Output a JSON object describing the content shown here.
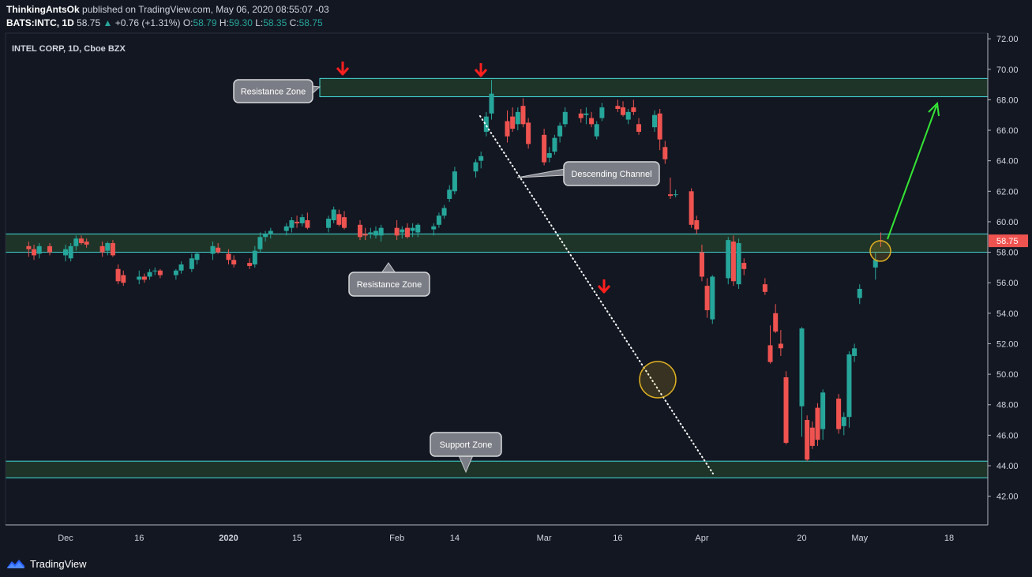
{
  "header": {
    "author": "ThinkingAntsOk",
    "published": "published on TradingView.com, May 06, 2020 08:55:07 -03",
    "symbol": "BATS:INTC, 1D",
    "last": "58.75",
    "change_arrow": "▲",
    "change": "+0.76 (+1.31%)",
    "o_label": "O:",
    "o_value": "58.79",
    "h_label": "H:",
    "h_value": "59.30",
    "l_label": "L:",
    "l_value": "58.35",
    "c_label": "C:",
    "c_value": "58.75"
  },
  "footer": {
    "brand": "TradingView",
    "icon": "tradingview-logo-icon"
  },
  "colors": {
    "background": "#131722",
    "up": "#26a69a",
    "down": "#ef5350",
    "zone_fill": "#1f3428",
    "zone_border": "#40d9d9",
    "arrow_down": "#ff1f1f",
    "arrow_projection": "#33e633",
    "circle": "#e0b020",
    "price_tag": "#ef5350"
  },
  "chart_data": {
    "type": "candlestick",
    "title": "INTEL CORP, 1D, Cboe BZX",
    "xlabel": "",
    "ylabel": "",
    "ylim": [
      41,
      72.5
    ],
    "y_ticks": [
      "42.00",
      "44.00",
      "46.00",
      "48.00",
      "50.00",
      "52.00",
      "54.00",
      "56.00",
      "58.00",
      "60.00",
      "62.00",
      "64.00",
      "66.00",
      "68.00",
      "70.00",
      "72.00"
    ],
    "x_ticks": [
      {
        "label": "Dec",
        "date": "2019-12-02"
      },
      {
        "label": "16",
        "date": "2019-12-16"
      },
      {
        "label": "2020",
        "date": "2020-01-02"
      },
      {
        "label": "15",
        "date": "2020-01-15"
      },
      {
        "label": "Feb",
        "date": "2020-02-03"
      },
      {
        "label": "14",
        "date": "2020-02-14"
      },
      {
        "label": "Mar",
        "date": "2020-03-02"
      },
      {
        "label": "16",
        "date": "2020-03-16"
      },
      {
        "label": "Apr",
        "date": "2020-04-01"
      },
      {
        "label": "20",
        "date": "2020-04-20"
      },
      {
        "label": "May",
        "date": "2020-05-01"
      },
      {
        "label": "18",
        "date": "2020-05-18"
      }
    ],
    "last_price": "58.75",
    "candles": [
      {
        "date": "2019-11-25",
        "o": 58.4,
        "h": 58.7,
        "l": 57.7,
        "c": 58.2
      },
      {
        "date": "2019-11-26",
        "o": 58.2,
        "h": 58.5,
        "l": 57.5,
        "c": 57.8
      },
      {
        "date": "2019-11-27",
        "o": 57.9,
        "h": 58.6,
        "l": 57.6,
        "c": 58.4
      },
      {
        "date": "2019-11-29",
        "o": 58.4,
        "h": 58.6,
        "l": 57.8,
        "c": 58.0
      },
      {
        "date": "2019-12-02",
        "o": 57.8,
        "h": 58.5,
        "l": 57.4,
        "c": 58.2
      },
      {
        "date": "2019-12-03",
        "o": 57.6,
        "h": 58.6,
        "l": 57.4,
        "c": 58.4
      },
      {
        "date": "2019-12-04",
        "o": 58.4,
        "h": 59.1,
        "l": 58.1,
        "c": 58.9
      },
      {
        "date": "2019-12-05",
        "o": 58.9,
        "h": 59.1,
        "l": 58.5,
        "c": 58.6
      },
      {
        "date": "2019-12-06",
        "o": 58.7,
        "h": 58.9,
        "l": 58.3,
        "c": 58.5
      },
      {
        "date": "2019-12-09",
        "o": 58.4,
        "h": 58.7,
        "l": 57.7,
        "c": 58.0
      },
      {
        "date": "2019-12-10",
        "o": 58.1,
        "h": 58.7,
        "l": 57.8,
        "c": 58.6
      },
      {
        "date": "2019-12-11",
        "o": 58.6,
        "h": 58.8,
        "l": 57.7,
        "c": 57.8
      },
      {
        "date": "2019-12-12",
        "o": 56.9,
        "h": 57.2,
        "l": 55.9,
        "c": 56.1
      },
      {
        "date": "2019-12-13",
        "o": 56.5,
        "h": 56.8,
        "l": 55.8,
        "c": 56.0
      },
      {
        "date": "2019-12-16",
        "o": 56.2,
        "h": 56.8,
        "l": 55.9,
        "c": 56.4
      },
      {
        "date": "2019-12-17",
        "o": 56.4,
        "h": 56.6,
        "l": 56.0,
        "c": 56.2
      },
      {
        "date": "2019-12-18",
        "o": 56.4,
        "h": 56.9,
        "l": 56.2,
        "c": 56.7
      },
      {
        "date": "2019-12-19",
        "o": 56.8,
        "h": 57.0,
        "l": 56.5,
        "c": 56.8
      },
      {
        "date": "2019-12-20",
        "o": 56.8,
        "h": 56.9,
        "l": 56.3,
        "c": 56.5
      },
      {
        "date": "2019-12-23",
        "o": 56.5,
        "h": 56.9,
        "l": 56.2,
        "c": 56.8
      },
      {
        "date": "2019-12-24",
        "o": 56.8,
        "h": 57.4,
        "l": 56.6,
        "c": 57.2
      },
      {
        "date": "2019-12-26",
        "o": 56.9,
        "h": 57.9,
        "l": 56.7,
        "c": 57.6
      },
      {
        "date": "2019-12-27",
        "o": 57.5,
        "h": 58.0,
        "l": 57.2,
        "c": 57.9
      },
      {
        "date": "2019-12-30",
        "o": 57.9,
        "h": 58.7,
        "l": 57.5,
        "c": 58.4
      },
      {
        "date": "2019-12-31",
        "o": 58.3,
        "h": 58.6,
        "l": 57.9,
        "c": 58.0
      },
      {
        "date": "2020-01-02",
        "o": 57.9,
        "h": 58.2,
        "l": 57.2,
        "c": 57.5
      },
      {
        "date": "2020-01-03",
        "o": 57.5,
        "h": 57.8,
        "l": 57.0,
        "c": 57.2
      },
      {
        "date": "2020-01-06",
        "o": 57.3,
        "h": 57.6,
        "l": 56.9,
        "c": 57.1
      },
      {
        "date": "2020-01-07",
        "o": 57.2,
        "h": 58.4,
        "l": 57.0,
        "c": 58.1
      },
      {
        "date": "2020-01-08",
        "o": 58.2,
        "h": 59.3,
        "l": 58.0,
        "c": 59.0
      },
      {
        "date": "2020-01-09",
        "o": 59.0,
        "h": 59.4,
        "l": 58.7,
        "c": 59.2
      },
      {
        "date": "2020-01-10",
        "o": 59.2,
        "h": 59.6,
        "l": 58.9,
        "c": 59.4
      },
      {
        "date": "2020-01-13",
        "o": 59.4,
        "h": 59.9,
        "l": 59.1,
        "c": 59.7
      },
      {
        "date": "2020-01-14",
        "o": 59.6,
        "h": 60.3,
        "l": 59.3,
        "c": 60.1
      },
      {
        "date": "2020-01-15",
        "o": 60.0,
        "h": 60.4,
        "l": 59.6,
        "c": 59.9
      },
      {
        "date": "2020-01-16",
        "o": 59.9,
        "h": 60.5,
        "l": 59.7,
        "c": 60.3
      },
      {
        "date": "2020-01-17",
        "o": 60.1,
        "h": 60.6,
        "l": 59.5,
        "c": 59.6
      },
      {
        "date": "2020-01-21",
        "o": 59.6,
        "h": 60.4,
        "l": 59.3,
        "c": 60.2
      },
      {
        "date": "2020-01-22",
        "o": 60.1,
        "h": 61.0,
        "l": 59.9,
        "c": 60.8
      },
      {
        "date": "2020-01-23",
        "o": 60.5,
        "h": 60.8,
        "l": 59.7,
        "c": 59.8
      },
      {
        "date": "2020-01-24",
        "o": 60.3,
        "h": 60.7,
        "l": 59.5,
        "c": 59.6
      },
      {
        "date": "2020-01-27",
        "o": 59.8,
        "h": 60.1,
        "l": 58.8,
        "c": 59.0
      },
      {
        "date": "2020-01-28",
        "o": 59.2,
        "h": 59.6,
        "l": 58.8,
        "c": 59.1
      },
      {
        "date": "2020-01-29",
        "o": 59.2,
        "h": 59.6,
        "l": 58.9,
        "c": 59.3
      },
      {
        "date": "2020-01-30",
        "o": 59.1,
        "h": 59.7,
        "l": 58.9,
        "c": 59.4
      },
      {
        "date": "2020-01-31",
        "o": 59.1,
        "h": 59.8,
        "l": 58.7,
        "c": 59.6
      },
      {
        "date": "2020-02-03",
        "o": 59.6,
        "h": 60.1,
        "l": 58.8,
        "c": 59.1
      },
      {
        "date": "2020-02-04",
        "o": 59.3,
        "h": 59.7,
        "l": 58.9,
        "c": 59.5
      },
      {
        "date": "2020-02-05",
        "o": 59.6,
        "h": 59.9,
        "l": 58.9,
        "c": 59.0
      },
      {
        "date": "2020-02-06",
        "o": 59.4,
        "h": 59.9,
        "l": 59.0,
        "c": 59.6
      },
      {
        "date": "2020-02-07",
        "o": 59.3,
        "h": 59.9,
        "l": 59.0,
        "c": 59.8
      },
      {
        "date": "2020-02-10",
        "o": 59.5,
        "h": 59.9,
        "l": 59.1,
        "c": 59.7
      },
      {
        "date": "2020-02-11",
        "o": 59.8,
        "h": 60.6,
        "l": 59.6,
        "c": 60.4
      },
      {
        "date": "2020-02-12",
        "o": 60.4,
        "h": 61.1,
        "l": 60.2,
        "c": 60.9
      },
      {
        "date": "2020-02-13",
        "o": 61.5,
        "h": 62.4,
        "l": 61.3,
        "c": 62.1
      },
      {
        "date": "2020-02-14",
        "o": 62.0,
        "h": 63.6,
        "l": 61.8,
        "c": 63.3
      },
      {
        "date": "2020-02-18",
        "o": 63.3,
        "h": 64.1,
        "l": 62.9,
        "c": 63.9
      },
      {
        "date": "2020-02-19",
        "o": 64.0,
        "h": 64.6,
        "l": 63.5,
        "c": 64.3
      },
      {
        "date": "2020-02-20",
        "o": 65.9,
        "h": 67.2,
        "l": 65.6,
        "c": 66.9
      },
      {
        "date": "2020-02-21",
        "o": 67.1,
        "h": 69.3,
        "l": 66.7,
        "c": 68.4
      },
      {
        "date": "2020-02-24",
        "o": 66.6,
        "h": 67.3,
        "l": 65.2,
        "c": 65.6
      },
      {
        "date": "2020-02-25",
        "o": 66.9,
        "h": 67.5,
        "l": 65.9,
        "c": 66.1
      },
      {
        "date": "2020-02-26",
        "o": 66.4,
        "h": 67.5,
        "l": 66.0,
        "c": 67.2
      },
      {
        "date": "2020-02-27",
        "o": 67.6,
        "h": 68.1,
        "l": 66.2,
        "c": 66.4
      },
      {
        "date": "2020-02-28",
        "o": 66.5,
        "h": 66.8,
        "l": 64.8,
        "c": 65.1
      },
      {
        "date": "2020-03-02",
        "o": 65.7,
        "h": 66.1,
        "l": 63.7,
        "c": 63.9
      },
      {
        "date": "2020-03-03",
        "o": 64.2,
        "h": 64.9,
        "l": 63.9,
        "c": 64.5
      },
      {
        "date": "2020-03-04",
        "o": 64.6,
        "h": 65.7,
        "l": 64.4,
        "c": 65.5
      },
      {
        "date": "2020-03-05",
        "o": 65.6,
        "h": 66.5,
        "l": 65.2,
        "c": 66.3
      },
      {
        "date": "2020-03-06",
        "o": 66.4,
        "h": 67.5,
        "l": 66.2,
        "c": 67.2
      },
      {
        "date": "2020-03-09",
        "o": 67.1,
        "h": 67.4,
        "l": 66.5,
        "c": 66.8
      },
      {
        "date": "2020-03-10",
        "o": 67.0,
        "h": 67.5,
        "l": 66.4,
        "c": 67.1
      },
      {
        "date": "2020-03-11",
        "o": 66.8,
        "h": 67.2,
        "l": 66.2,
        "c": 66.4
      },
      {
        "date": "2020-03-12",
        "o": 65.6,
        "h": 66.6,
        "l": 65.4,
        "c": 66.4
      },
      {
        "date": "2020-03-13",
        "o": 66.8,
        "h": 67.8,
        "l": 66.6,
        "c": 67.5
      },
      {
        "date": "2020-03-16",
        "o": 67.6,
        "h": 68.0,
        "l": 67.2,
        "c": 67.4
      },
      {
        "date": "2020-03-17",
        "o": 67.5,
        "h": 67.9,
        "l": 66.9,
        "c": 67.0
      },
      {
        "date": "2020-03-18",
        "o": 66.7,
        "h": 67.4,
        "l": 66.4,
        "c": 67.2
      },
      {
        "date": "2020-03-19",
        "o": 67.5,
        "h": 68.0,
        "l": 67.0,
        "c": 67.2
      },
      {
        "date": "2020-03-20",
        "o": 66.4,
        "h": 66.8,
        "l": 65.7,
        "c": 65.9
      },
      {
        "date": "2020-03-23",
        "o": 66.2,
        "h": 67.3,
        "l": 65.9,
        "c": 67.0
      },
      {
        "date": "2020-03-24",
        "o": 67.1,
        "h": 67.4,
        "l": 64.7,
        "c": 65.4
      },
      {
        "date": "2020-03-25",
        "o": 64.9,
        "h": 65.3,
        "l": 63.8,
        "c": 64.1
      },
      {
        "date": "2020-03-26",
        "o": 61.8,
        "h": 62.9,
        "l": 61.5,
        "c": 61.7
      },
      {
        "date": "2020-03-27",
        "o": 61.8,
        "h": 62.1,
        "l": 61.6,
        "c": 61.8
      },
      {
        "date": "2020-03-30",
        "o": 62.0,
        "h": 62.2,
        "l": 59.6,
        "c": 59.8
      },
      {
        "date": "2020-03-31",
        "o": 60.1,
        "h": 60.4,
        "l": 59.2,
        "c": 59.5
      },
      {
        "date": "2020-04-01",
        "o": 58.0,
        "h": 58.5,
        "l": 56.1,
        "c": 56.4
      },
      {
        "date": "2020-04-02",
        "o": 55.8,
        "h": 56.3,
        "l": 53.7,
        "c": 54.2
      },
      {
        "date": "2020-04-03",
        "o": 53.6,
        "h": 56.5,
        "l": 53.3,
        "c": 56.4
      },
      {
        "date": "2020-04-06",
        "o": 56.3,
        "h": 59.0,
        "l": 55.9,
        "c": 58.8
      },
      {
        "date": "2020-04-07",
        "o": 58.7,
        "h": 59.1,
        "l": 55.8,
        "c": 56.1
      },
      {
        "date": "2020-04-08",
        "o": 55.9,
        "h": 58.9,
        "l": 55.6,
        "c": 58.6
      },
      {
        "date": "2020-04-09",
        "o": 57.3,
        "h": 57.6,
        "l": 56.5,
        "c": 56.9
      },
      {
        "date": "2020-04-13",
        "o": 55.9,
        "h": 56.3,
        "l": 55.2,
        "c": 55.4
      },
      {
        "date": "2020-04-14",
        "o": 51.9,
        "h": 53.2,
        "l": 50.7,
        "c": 50.8
      },
      {
        "date": "2020-04-15",
        "o": 54.0,
        "h": 54.6,
        "l": 52.7,
        "c": 52.8
      },
      {
        "date": "2020-04-16",
        "o": 52.0,
        "h": 52.9,
        "l": 51.2,
        "c": 51.7
      },
      {
        "date": "2020-04-17",
        "o": 49.8,
        "h": 50.2,
        "l": 45.4,
        "c": 45.5
      },
      {
        "date": "2020-04-20",
        "o": 47.9,
        "h": 53.1,
        "l": 45.9,
        "c": 53.0
      },
      {
        "date": "2020-04-21",
        "o": 47.0,
        "h": 47.3,
        "l": 44.3,
        "c": 44.4
      },
      {
        "date": "2020-04-22",
        "o": 46.5,
        "h": 46.9,
        "l": 45.1,
        "c": 45.3
      },
      {
        "date": "2020-04-23",
        "o": 47.8,
        "h": 48.1,
        "l": 45.3,
        "c": 45.7
      },
      {
        "date": "2020-04-24",
        "o": 46.4,
        "h": 49.0,
        "l": 45.7,
        "c": 48.8
      },
      {
        "date": "2020-04-27",
        "o": 48.4,
        "h": 48.7,
        "l": 46.1,
        "c": 46.4
      },
      {
        "date": "2020-04-28",
        "o": 46.6,
        "h": 47.5,
        "l": 46.0,
        "c": 47.2
      },
      {
        "date": "2020-04-29",
        "o": 47.2,
        "h": 51.5,
        "l": 46.5,
        "c": 51.3
      },
      {
        "date": "2020-04-30",
        "o": 51.2,
        "h": 52.0,
        "l": 50.8,
        "c": 51.7
      },
      {
        "date": "2020-05-01",
        "o": 55.0,
        "h": 55.9,
        "l": 54.6,
        "c": 55.6
      },
      {
        "date": "2020-05-04",
        "o": 57.0,
        "h": 58.0,
        "l": 56.2,
        "c": 57.5
      },
      {
        "date": "2020-05-05",
        "o": 58.79,
        "h": 59.3,
        "l": 58.35,
        "c": 58.75
      }
    ],
    "zones": [
      {
        "label": "Resistance Zone",
        "low": 68.2,
        "high": 69.4
      },
      {
        "label": "Resistance Zone",
        "low": 58.0,
        "high": 59.2
      },
      {
        "label": "Support Zone",
        "low": 43.2,
        "high": 44.3
      }
    ],
    "annotations": [
      {
        "text": "Resistance Zone"
      },
      {
        "text": "Resistance Zone"
      },
      {
        "text": "Descending Channel"
      },
      {
        "text": "Support Zone"
      }
    ]
  }
}
